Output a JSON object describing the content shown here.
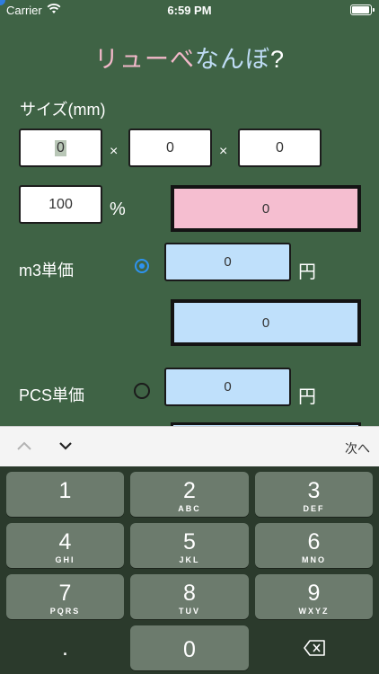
{
  "status": {
    "carrier": "Carrier",
    "time": "6:59 PM"
  },
  "title": {
    "part1": "リュー",
    "part2": "べ",
    "part3": "なんぼ",
    "part4": "?"
  },
  "size": {
    "label": "サイズ(mm)",
    "w": "0",
    "d": "0",
    "h": "0",
    "times": "×",
    "percent": "100",
    "percent_unit": "%",
    "result": "0"
  },
  "m3": {
    "label": "m3単価",
    "price": "0",
    "yen": "円",
    "result": "0",
    "selected": true
  },
  "pcs": {
    "label": "PCS単価",
    "price": "0",
    "yen": "円",
    "selected": false
  },
  "toolbar": {
    "next_label": "次へ"
  },
  "keypad": {
    "k1": {
      "num": "1",
      "sub": ""
    },
    "k2": {
      "num": "2",
      "sub": "ABC"
    },
    "k3": {
      "num": "3",
      "sub": "DEF"
    },
    "k4": {
      "num": "4",
      "sub": "GHI"
    },
    "k5": {
      "num": "5",
      "sub": "JKL"
    },
    "k6": {
      "num": "6",
      "sub": "MNO"
    },
    "k7": {
      "num": "7",
      "sub": "PQRS"
    },
    "k8": {
      "num": "8",
      "sub": "TUV"
    },
    "k9": {
      "num": "9",
      "sub": "WXYZ"
    },
    "dot": ".",
    "k0": "0"
  },
  "colors": {
    "background": "#3f6345",
    "pink": "#f5bed0",
    "blue": "#bfe0fb",
    "radio": "#2e93f0"
  }
}
